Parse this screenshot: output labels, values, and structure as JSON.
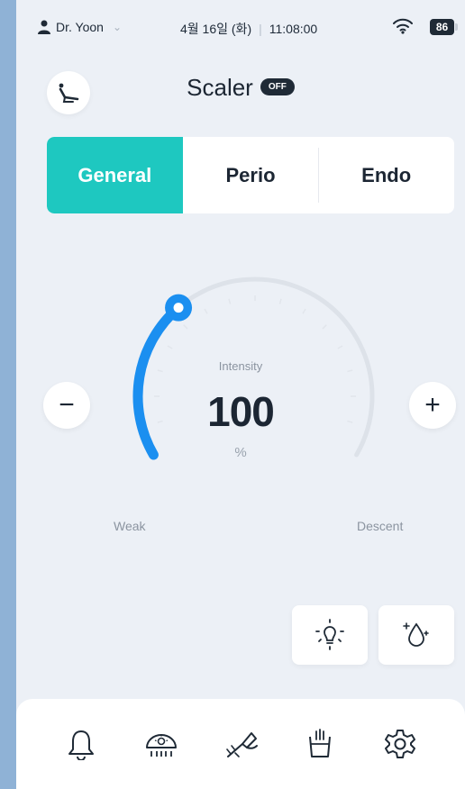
{
  "status": {
    "user": "Dr. Yoon",
    "date": "4월 16일 (화)",
    "time": "11:08:00",
    "battery": "86"
  },
  "header": {
    "title": "Scaler",
    "badge": "OFF"
  },
  "tabs": [
    {
      "label": "General",
      "active": true
    },
    {
      "label": "Perio",
      "active": false
    },
    {
      "label": "Endo",
      "active": false
    }
  ],
  "dial": {
    "label": "Intensity",
    "value": "100",
    "unit": "%",
    "min_label": "Weak",
    "max_label": "Descent",
    "level_fraction": 0.33
  },
  "controls": {
    "minus": "−",
    "plus": "+"
  },
  "colors": {
    "accent": "#1ec8c0",
    "dial": "#1b8ff0",
    "track": "#dde2e9",
    "dark": "#1f2a36"
  },
  "icons": {
    "chair": "dental-chair-icon",
    "light": "light-bulb-icon",
    "water": "water-drop-icon",
    "nav": [
      "bell-icon",
      "lamp-icon",
      "scaler-icon",
      "cup-icon",
      "settings-icon"
    ]
  }
}
